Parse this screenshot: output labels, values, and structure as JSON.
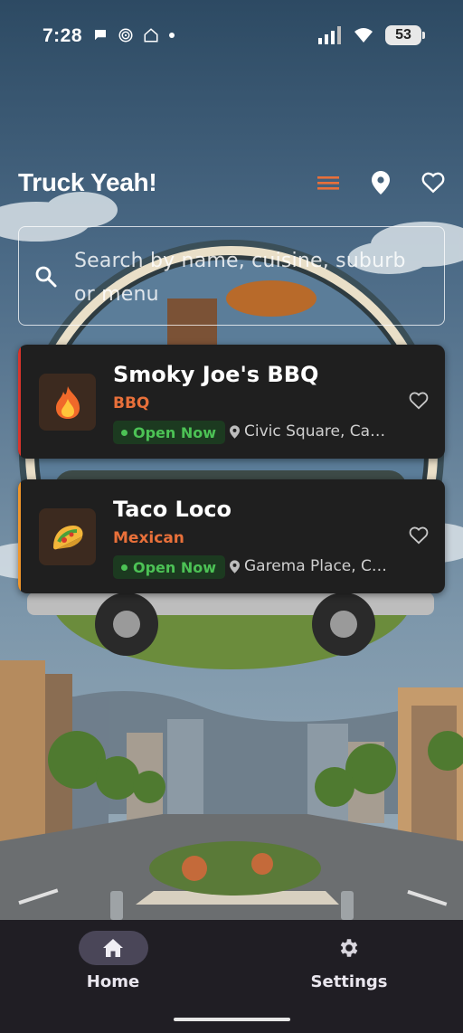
{
  "status_bar": {
    "time": "7:28",
    "battery": "53"
  },
  "app_bar": {
    "title": "Truck Yeah!",
    "accent_color": "#e8703a"
  },
  "search": {
    "placeholder": "Search by name, cuisine, suburb or menu"
  },
  "trucks": [
    {
      "name": "Smoky Joe's BBQ",
      "cuisine": "BBQ",
      "status": "Open Now",
      "location": "Civic Square, Ca…",
      "icon": "fire-icon",
      "accent": "#d9342b"
    },
    {
      "name": "Taco Loco",
      "cuisine": "Mexican",
      "status": "Open Now",
      "location": "Garema Place, C…",
      "icon": "taco-icon",
      "accent": "#f0962a"
    }
  ],
  "bottom_nav": {
    "items": [
      {
        "label": "Home",
        "icon": "home-icon",
        "active": true
      },
      {
        "label": "Settings",
        "icon": "gear-icon",
        "active": false
      }
    ]
  }
}
